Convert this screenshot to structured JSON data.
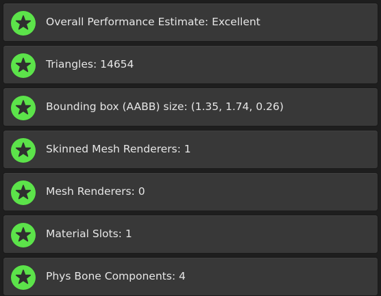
{
  "performance_rows": [
    {
      "label": "Overall Performance Estimate: Excellent",
      "icon": "star-badge-icon",
      "rating": "Excellent"
    },
    {
      "label": "Triangles: 14654",
      "icon": "star-badge-icon",
      "rating": "Excellent"
    },
    {
      "label": "Bounding box (AABB) size: (1.35, 1.74, 0.26)",
      "icon": "star-badge-icon",
      "rating": "Excellent"
    },
    {
      "label": "Skinned Mesh Renderers: 1",
      "icon": "star-badge-icon",
      "rating": "Excellent"
    },
    {
      "label": "Mesh Renderers: 0",
      "icon": "star-badge-icon",
      "rating": "Excellent"
    },
    {
      "label": "Material Slots: 1",
      "icon": "star-badge-icon",
      "rating": "Excellent"
    },
    {
      "label": "Phys Bone Components: 4",
      "icon": "star-badge-icon",
      "rating": "Excellent"
    }
  ],
  "colors": {
    "excellent_badge": "#5ce34a",
    "star": "#2f2f2f",
    "row_background": "#383838",
    "text": "#e6e6e6"
  }
}
